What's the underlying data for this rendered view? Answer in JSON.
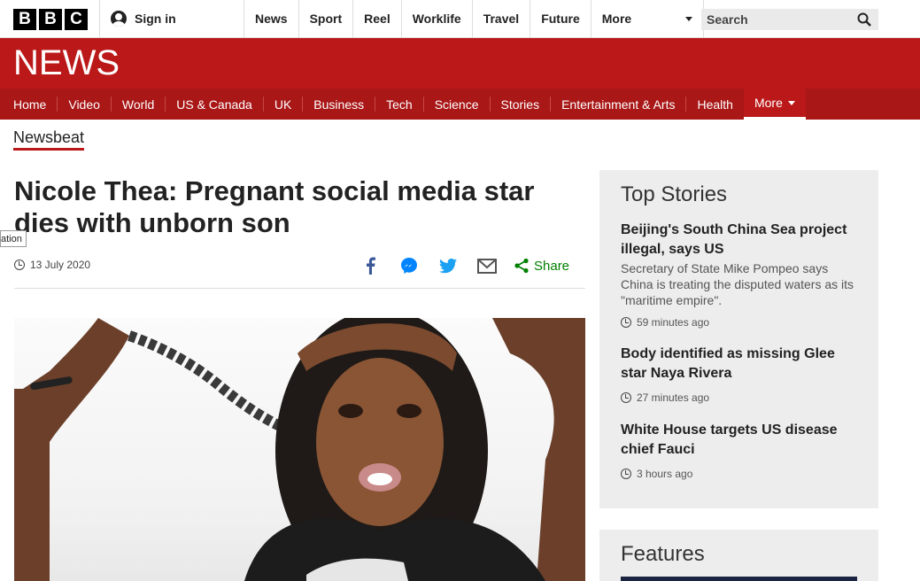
{
  "topbar": {
    "logo_letters": [
      "B",
      "B",
      "C"
    ],
    "signin_label": "Sign in",
    "nav": [
      "News",
      "Sport",
      "Reel",
      "Worklife",
      "Travel",
      "Future"
    ],
    "more_label": "More",
    "search_placeholder": "Search"
  },
  "banner": {
    "title": "NEWS"
  },
  "nav": {
    "items": [
      "Home",
      "Video",
      "World",
      "US & Canada",
      "UK",
      "Business",
      "Tech",
      "Science",
      "Stories",
      "Entertainment & Arts",
      "Health"
    ],
    "more_label": "More"
  },
  "section": {
    "label": "Newsbeat"
  },
  "article": {
    "headline": "Nicole Thea: Pregnant social media star dies with unborn son",
    "tooltip": "ation",
    "date": "13 July 2020",
    "share_label": "Share",
    "share_icons": [
      "facebook-icon",
      "messenger-icon",
      "twitter-icon",
      "email-icon",
      "share-icon"
    ]
  },
  "sidebar": {
    "top_stories_title": "Top Stories",
    "stories": [
      {
        "title": "Beijing's South China Sea project illegal, says US",
        "summary": "Secretary of State Mike Pompeo says China is treating the disputed waters as its \"maritime empire\".",
        "time": "59 minutes ago"
      },
      {
        "title": "Body identified as missing Glee star Naya Rivera",
        "summary": "",
        "time": "27 minutes ago"
      },
      {
        "title": "White House targets US disease chief Fauci",
        "summary": "",
        "time": "3 hours ago"
      }
    ],
    "features_title": "Features"
  },
  "colors": {
    "brand_red": "#bb1919",
    "nav_red": "#a91717",
    "share_green": "#007f00",
    "twitter": "#1da1f2",
    "facebook": "#3b5998",
    "messenger": "#0084ff"
  }
}
